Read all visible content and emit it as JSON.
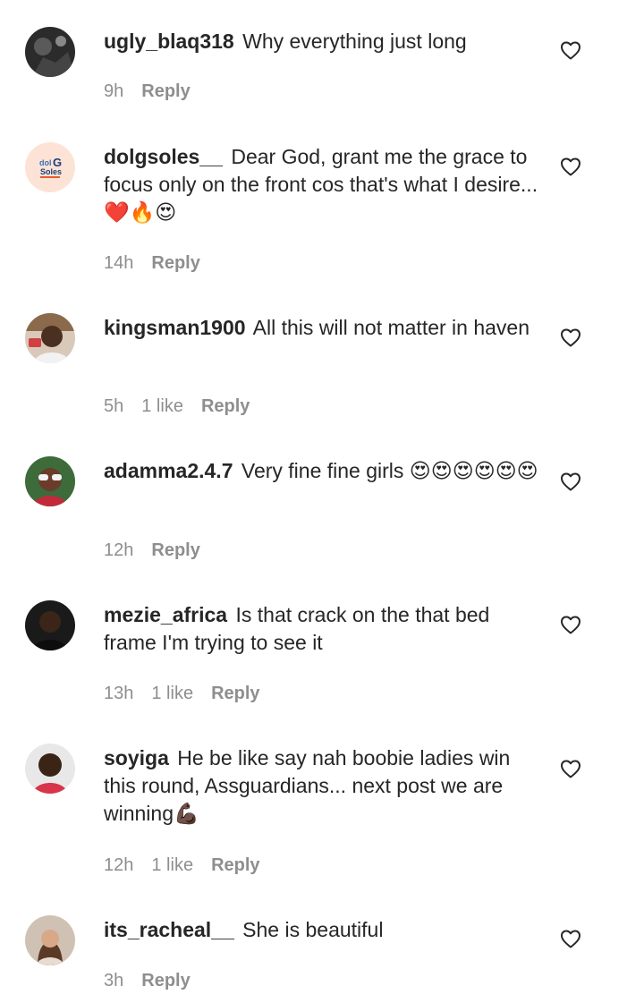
{
  "comments": [
    {
      "username": "ugly_blaq318",
      "text": "Why everything just long",
      "time": "9h",
      "likes": "",
      "reply": "Reply",
      "avatar_icon": "avatar-photo-dark"
    },
    {
      "username": "dolgsoles__",
      "text": "Dear God, grant me the grace to focus only on the front cos that's what I desire... ❤️🔥😍",
      "time": "14h",
      "likes": "",
      "reply": "Reply",
      "avatar_icon": "avatar-logo-dolg-soles",
      "avatar_logo_text": "dolG Soles"
    },
    {
      "username": "kingsman1900",
      "text": "All this will not matter in haven",
      "time": "5h",
      "likes": "1 like",
      "reply": "Reply",
      "avatar_icon": "avatar-photo"
    },
    {
      "username": "adamma2.4.7",
      "text": "Very fine fine girls 😍😍😍😍😍😍",
      "time": "12h",
      "likes": "",
      "reply": "Reply",
      "avatar_icon": "avatar-photo"
    },
    {
      "username": "mezie_africa",
      "text": "Is that crack on the that bed frame I'm trying to see it",
      "time": "13h",
      "likes": "1 like",
      "reply": "Reply",
      "avatar_icon": "avatar-photo"
    },
    {
      "username": "soyiga",
      "text": "He be like say nah boobie ladies win this round, Assguardians... next post we are winning💪🏿",
      "time": "12h",
      "likes": "1 like",
      "reply": "Reply",
      "avatar_icon": "avatar-photo"
    },
    {
      "username": "its_racheal__",
      "text": "She is beautiful",
      "time": "3h",
      "likes": "",
      "reply": "Reply",
      "avatar_icon": "avatar-photo"
    }
  ],
  "colors": {
    "text": "#262626",
    "secondary_text": "#8e8e8e",
    "background": "#ffffff"
  }
}
